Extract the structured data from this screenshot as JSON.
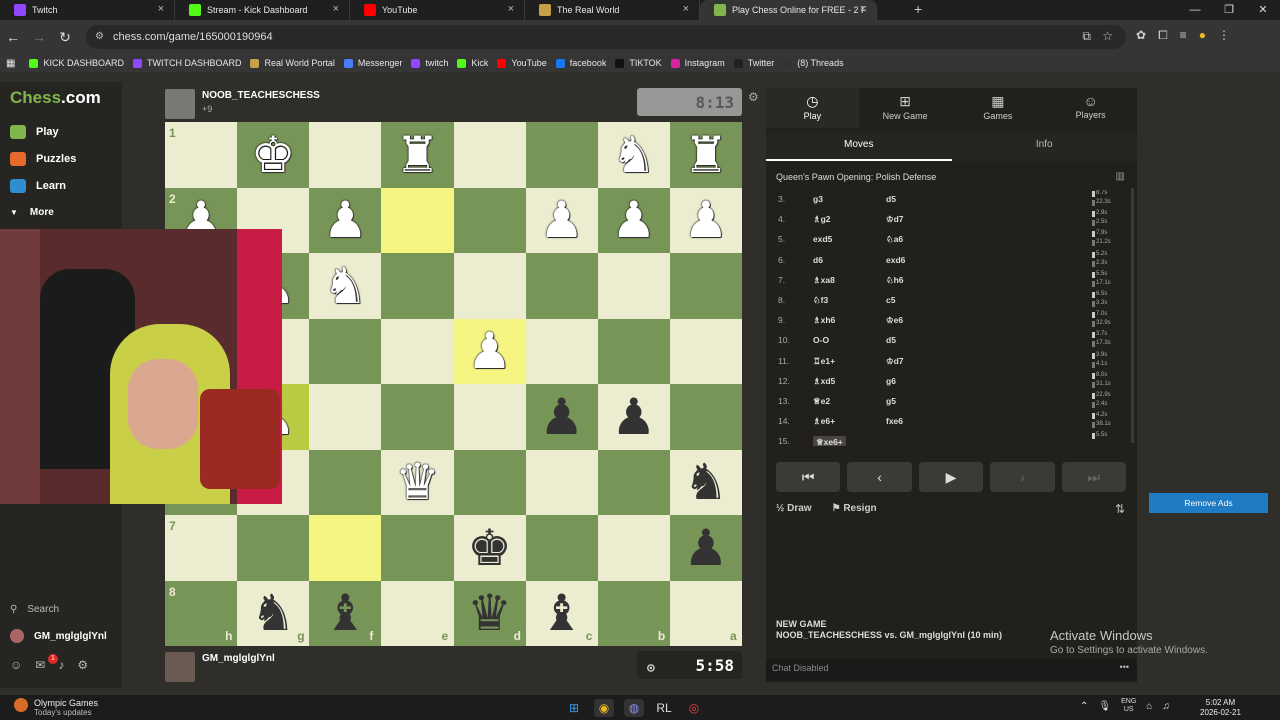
{
  "browser": {
    "tabs": [
      {
        "title": "Twitch",
        "color": "#9146ff"
      },
      {
        "title": "Stream - Kick Dashboard",
        "color": "#53fc18"
      },
      {
        "title": "YouTube",
        "color": "#ff0000"
      },
      {
        "title": "The Real World",
        "color": "#c9a04a"
      },
      {
        "title": "Play Chess Online for FREE - 2 F",
        "color": "#81b64c"
      }
    ],
    "url": "chess.com/game/165000190964",
    "bookmarks": [
      {
        "label": "KICK DASHBOARD",
        "color": "#53fc18"
      },
      {
        "label": "TWITCH DASHBOARD",
        "color": "#9146ff"
      },
      {
        "label": "Real World Portal",
        "color": "#c9a04a"
      },
      {
        "label": "Messenger",
        "color": "#4a7dfc"
      },
      {
        "label": "twitch",
        "color": "#9146ff"
      },
      {
        "label": "Kick",
        "color": "#53fc18"
      },
      {
        "label": "YouTube",
        "color": "#ff0000"
      },
      {
        "label": "facebook",
        "color": "#1877f2"
      },
      {
        "label": "TIKTOK",
        "color": "#111111"
      },
      {
        "label": "Instagram",
        "color": "#d6249f"
      },
      {
        "label": "Twitter",
        "color": "#222222"
      },
      {
        "label": "(8) Threads",
        "color": "#333333"
      }
    ]
  },
  "nav": {
    "logo_prefix": "Chess",
    "logo_suffix": ".com",
    "items": [
      {
        "label": "Play",
        "color": "#81b64c"
      },
      {
        "label": "Puzzles",
        "color": "#e66a2c"
      },
      {
        "label": "Learn",
        "color": "#2f8dd0"
      }
    ],
    "more": "More",
    "search": "Search",
    "user": "GM_mglglglYnl",
    "notif_count": "1"
  },
  "top_player": {
    "name": "NOOB_TEACHESCHESS",
    "sub": "+9",
    "clock": "8:13"
  },
  "bottom_player": {
    "name": "GM_mglglglYnl",
    "clock": "5:58"
  },
  "board": {
    "rank_labels": [
      "1",
      "2",
      "3",
      "4",
      "5",
      "6",
      "7",
      "8"
    ],
    "file_labels": [
      "h",
      "g",
      "f",
      "e",
      "d",
      "c",
      "b",
      "a"
    ]
  },
  "panel": {
    "top_nav": [
      {
        "label": "Play",
        "icon": "◷"
      },
      {
        "label": "New Game",
        "icon": "⊞"
      },
      {
        "label": "Games",
        "icon": "▦"
      },
      {
        "label": "Players",
        "icon": "☺"
      }
    ],
    "tabs": [
      "Moves",
      "Info"
    ],
    "opening": "Queen's Pawn Opening: Polish Defense",
    "moves": [
      {
        "n": "3.",
        "w": "g3",
        "b": "d5",
        "t1": "8.7s",
        "t2": "22.3s"
      },
      {
        "n": "4.",
        "w": "♗g2",
        "b": "♔d7",
        "t1": "2.9s",
        "t2": "2.5s"
      },
      {
        "n": "5.",
        "w": "exd5",
        "b": "♘a6",
        "t1": "7.9s",
        "t2": "21.2s"
      },
      {
        "n": "6.",
        "w": "d6",
        "b": "exd6",
        "t1": "5.2s",
        "t2": "2.3s"
      },
      {
        "n": "7.",
        "w": "♗xa8",
        "b": "♘h6",
        "t1": "5.5s",
        "t2": "17.1s"
      },
      {
        "n": "8.",
        "w": "♘f3",
        "b": "c5",
        "t1": "6.5s",
        "t2": "3.3s"
      },
      {
        "n": "9.",
        "w": "♗xh6",
        "b": "♔e6",
        "t1": "7.0s",
        "t2": "32.9s"
      },
      {
        "n": "10.",
        "w": "O-O",
        "b": "d5",
        "t1": "3.7s",
        "t2": "17.3s"
      },
      {
        "n": "11.",
        "w": "♖e1+",
        "b": "♔d7",
        "t1": "3.9s",
        "t2": "4.1s"
      },
      {
        "n": "12.",
        "w": "♗xd5",
        "b": "g6",
        "t1": "8.0s",
        "t2": "31.1s"
      },
      {
        "n": "13.",
        "w": "♕e2",
        "b": "g5",
        "t1": "22.9s",
        "t2": "2.4s"
      },
      {
        "n": "14.",
        "w": "♗e6+",
        "b": "fxe6",
        "t1": "4.2s",
        "t2": "38.1s"
      },
      {
        "n": "15.",
        "w": "♕xe6+",
        "b": "",
        "t1": "5.5s",
        "t2": ""
      }
    ],
    "controls": [
      "⏮",
      "‹",
      "▶",
      "›",
      "⏭"
    ],
    "draw": "Draw",
    "draw_prefix": "½",
    "resign": "Resign",
    "new_game_title": "NEW GAME",
    "new_game_desc": "NOOB_TEACHESCHESS vs. GM_mglglglYnl (10 min)",
    "chat": "Chat Disabled"
  },
  "ad": {
    "remove": "Remove Ads"
  },
  "watermark": {
    "line1": "Activate Windows",
    "line2": "Go to Settings to activate Windows."
  },
  "taskbar": {
    "news_title": "Olympic Games",
    "news_sub": "Today's updates",
    "lang1": "ENG",
    "lang2": "US",
    "time": "5:02 AM",
    "date": "2026-02-21"
  }
}
